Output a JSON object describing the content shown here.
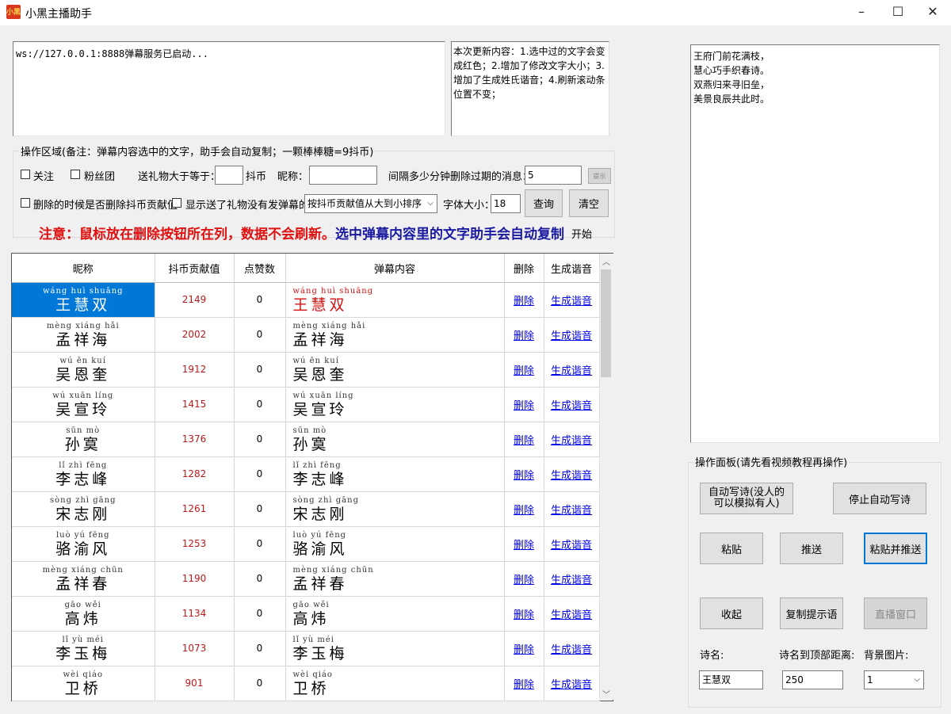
{
  "window": {
    "title": "小黑主播助手",
    "icon_text": "小黑",
    "controls": [
      "–",
      "☐",
      "✕"
    ]
  },
  "log": {
    "text": "ws://127.0.0.1:8888弹幕服务已启动..."
  },
  "update_notes": {
    "text": "本次更新内容：1.选中过的文字会变成红色；2.增加了修改文字大小；3.增加了生成姓氏谐音；4.刷新滚动条位置不变；"
  },
  "poem": {
    "lines": [
      "王府门前花满枝，",
      "慧心巧手织春诗。",
      "双燕归来寻旧垒，",
      "美景良辰共此时。"
    ]
  },
  "ops": {
    "header": "操作区域(备注：弹幕内容选中的文字，助手会自动复制；一颗棒棒糖=9抖币)",
    "follow_label": "关注",
    "fans_label": "粉丝团",
    "gift_gte_label": "送礼物大于等于：",
    "gift_gte_value": "",
    "douyin_coin_label": "抖币",
    "nickname_label": "昵称：",
    "nickname_value": "",
    "expire_label": "间隔多少分钟删除过期的消息：",
    "expire_value": "5",
    "small_btn": "提示",
    "delete_coin_label": "删除的时候是否删除抖币贡献值",
    "show_no_comment_label": "显示送了礼物没有发弹幕的",
    "sort_value": "按抖币贡献值从大到小排序",
    "font_size_label": "字体大小：",
    "font_size_value": "18",
    "query_btn": "查询",
    "clear_btn": "清空",
    "notice_red": "注意：鼠标放在删除按钮所在列，数据不会刷新。",
    "notice_blue": "选中弹幕内容里的文字助手会自动复制",
    "start_label": "开始"
  },
  "table": {
    "headers": [
      "昵称",
      "抖币贡献值",
      "点赞数",
      "弹幕内容",
      "删除",
      "生成谐音"
    ],
    "delete_link": "删除",
    "homophone_link": "生成谐音",
    "rows": [
      {
        "py": "wáng huì shuāng",
        "name": "王慧双",
        "coins": "2149",
        "likes": "0",
        "content_red": true
      },
      {
        "py": "mèng xiáng hǎi",
        "name": "孟祥海",
        "coins": "2002",
        "likes": "0"
      },
      {
        "py": "wú ēn kuí",
        "name": "吴恩奎",
        "coins": "1912",
        "likes": "0"
      },
      {
        "py": "wú xuān líng",
        "name": "吴宣玲",
        "coins": "1415",
        "likes": "0"
      },
      {
        "py": "sūn mò",
        "name": "孙寞",
        "coins": "1376",
        "likes": "0"
      },
      {
        "py": "lǐ zhì fēng",
        "name": "李志峰",
        "coins": "1282",
        "likes": "0"
      },
      {
        "py": "sòng zhì gāng",
        "name": "宋志刚",
        "coins": "1261",
        "likes": "0"
      },
      {
        "py": "luò yú fēng",
        "name": "骆渝风",
        "coins": "1253",
        "likes": "0"
      },
      {
        "py": "mèng xiáng chūn",
        "name": "孟祥春",
        "coins": "1190",
        "likes": "0"
      },
      {
        "py": "gāo wěi",
        "name": "高炜",
        "coins": "1134",
        "likes": "0"
      },
      {
        "py": "lǐ yù méi",
        "name": "李玉梅",
        "coins": "1073",
        "likes": "0"
      },
      {
        "py": "wèi qiáo",
        "name": "卫桥",
        "coins": "901",
        "likes": "0"
      }
    ]
  },
  "panel": {
    "header": "操作面板(请先看视频教程再操作)",
    "auto_poem_btn": "自动写诗(没人的可以模拟有人)",
    "stop_poem_btn": "停止自动写诗",
    "paste_btn": "粘贴",
    "push_btn": "推送",
    "paste_push_btn": "粘贴并推送",
    "collapse_btn": "收起",
    "copy_prompt_btn": "复制提示语",
    "live_window_btn": "直播窗口",
    "poem_name_label": "诗名:",
    "poem_top_label": "诗名到顶部距离:",
    "bg_label": "背景图片:",
    "poem_name_value": "王慧双",
    "poem_top_value": "250",
    "bg_value": "1"
  }
}
